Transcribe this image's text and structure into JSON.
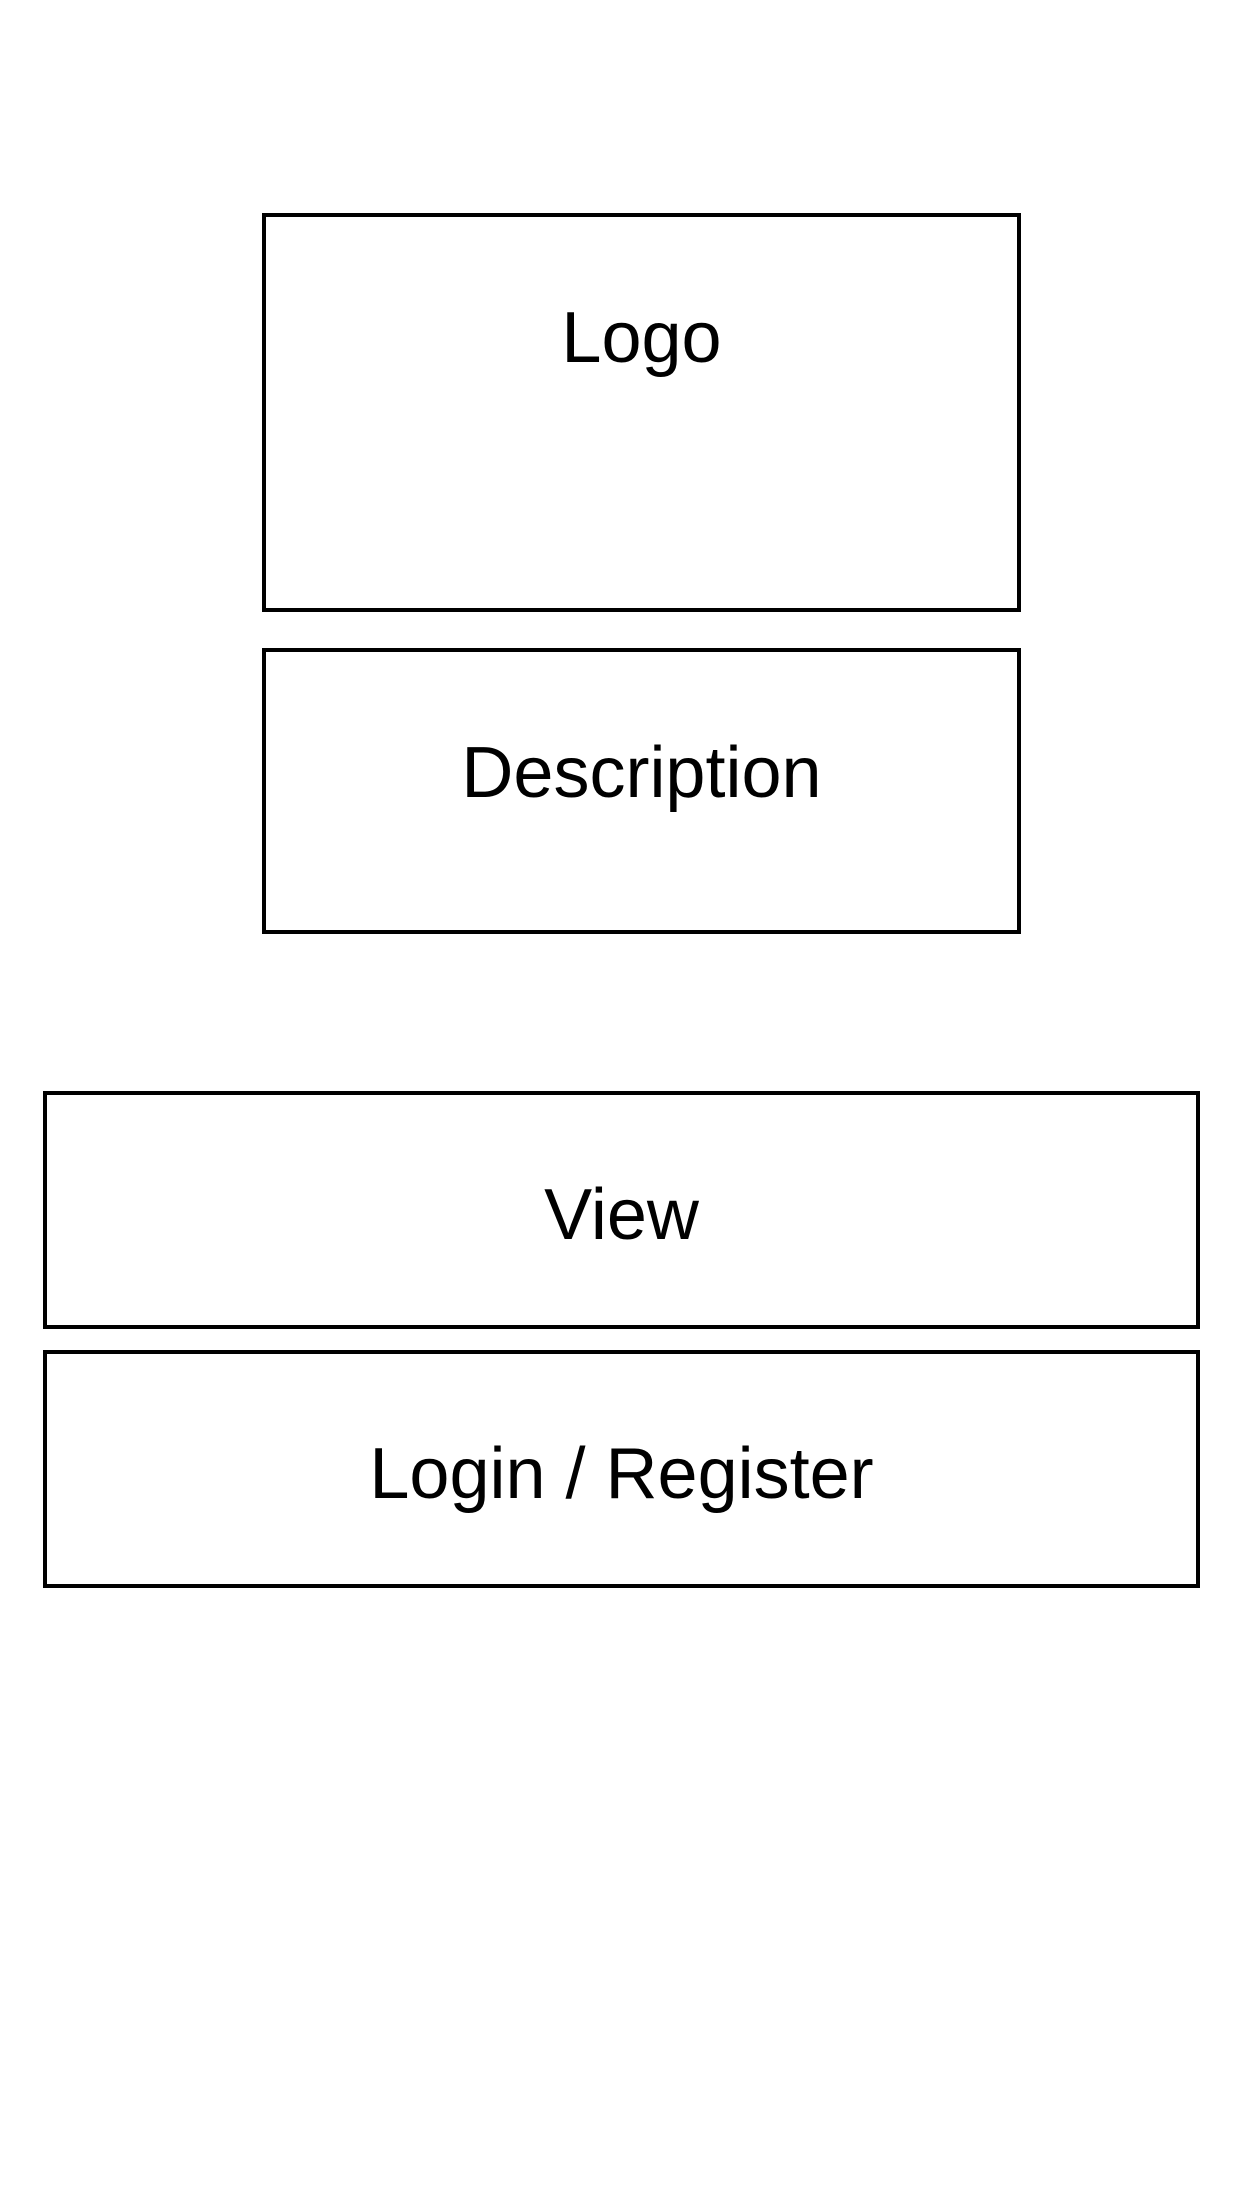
{
  "header": {
    "logo_label": "Logo",
    "description_label": "Description"
  },
  "actions": {
    "view_label": "View",
    "login_register_label": "Login / Register"
  },
  "colors": {
    "border": "#000000",
    "background": "#ffffff",
    "text": "#000000"
  }
}
